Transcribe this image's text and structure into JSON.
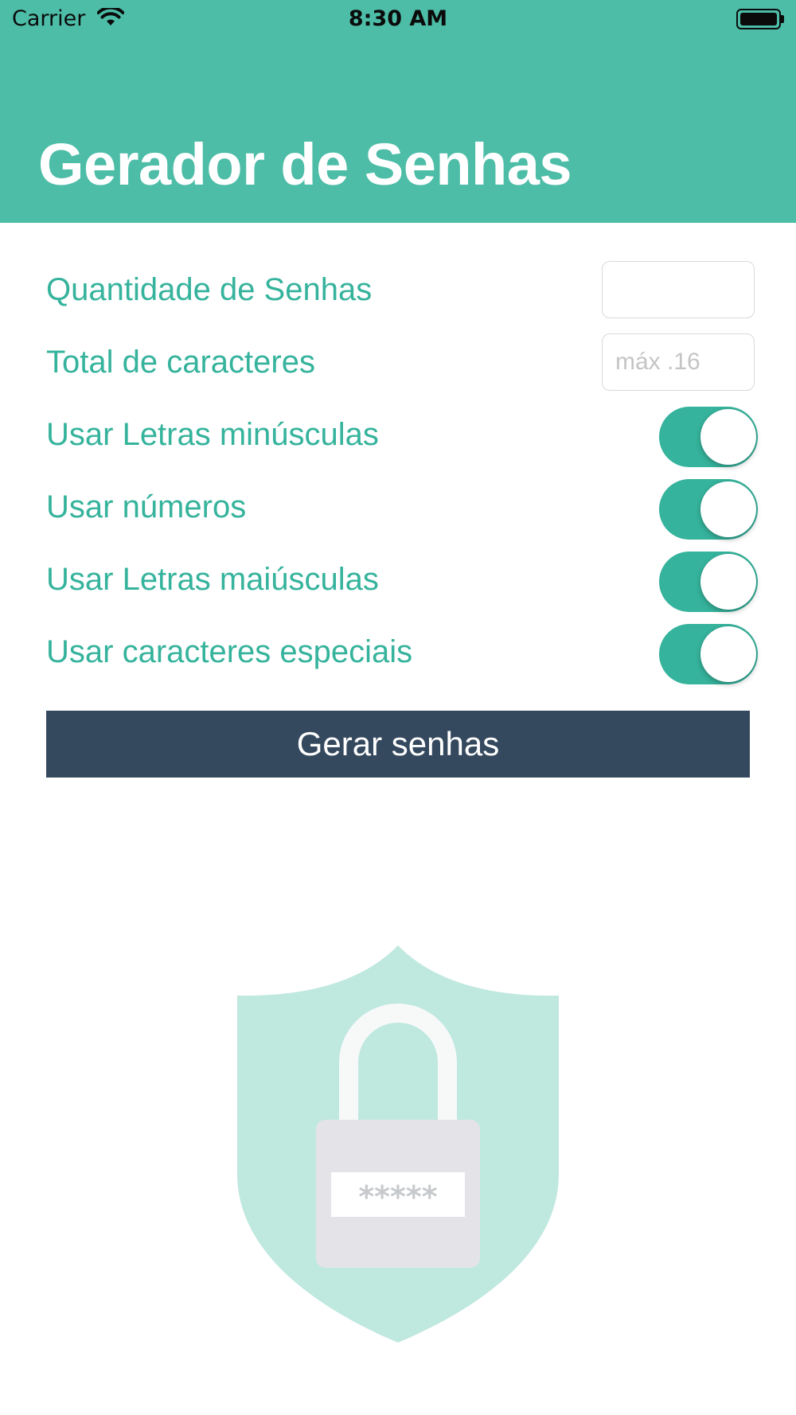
{
  "status_bar": {
    "carrier": "Carrier",
    "time": "8:30 AM",
    "wifi_icon": "wifi-icon",
    "battery_icon": "battery-icon"
  },
  "header": {
    "title": "Gerador de Senhas"
  },
  "form": {
    "password_quantity": {
      "label": "Quantidade de Senhas",
      "value": "",
      "placeholder": ""
    },
    "total_characters": {
      "label": "Total de caracteres",
      "value": "",
      "placeholder": "máx .16"
    },
    "toggles": [
      {
        "label": "Usar Letras minúsculas",
        "on": true
      },
      {
        "label": "Usar números",
        "on": true
      },
      {
        "label": "Usar Letras maiúsculas",
        "on": true
      },
      {
        "label": "Usar caracteres especiais",
        "on": true
      }
    ]
  },
  "generate_button": {
    "label": "Gerar senhas"
  },
  "illustration": {
    "icon": "shield-lock-icon",
    "masked_password": "*****"
  },
  "colors": {
    "header_background": "#4dbda7",
    "accent": "#35b39c",
    "button_background": "#35495e",
    "shield": "#bfe8df",
    "lock_body": "#e4e4e8"
  }
}
